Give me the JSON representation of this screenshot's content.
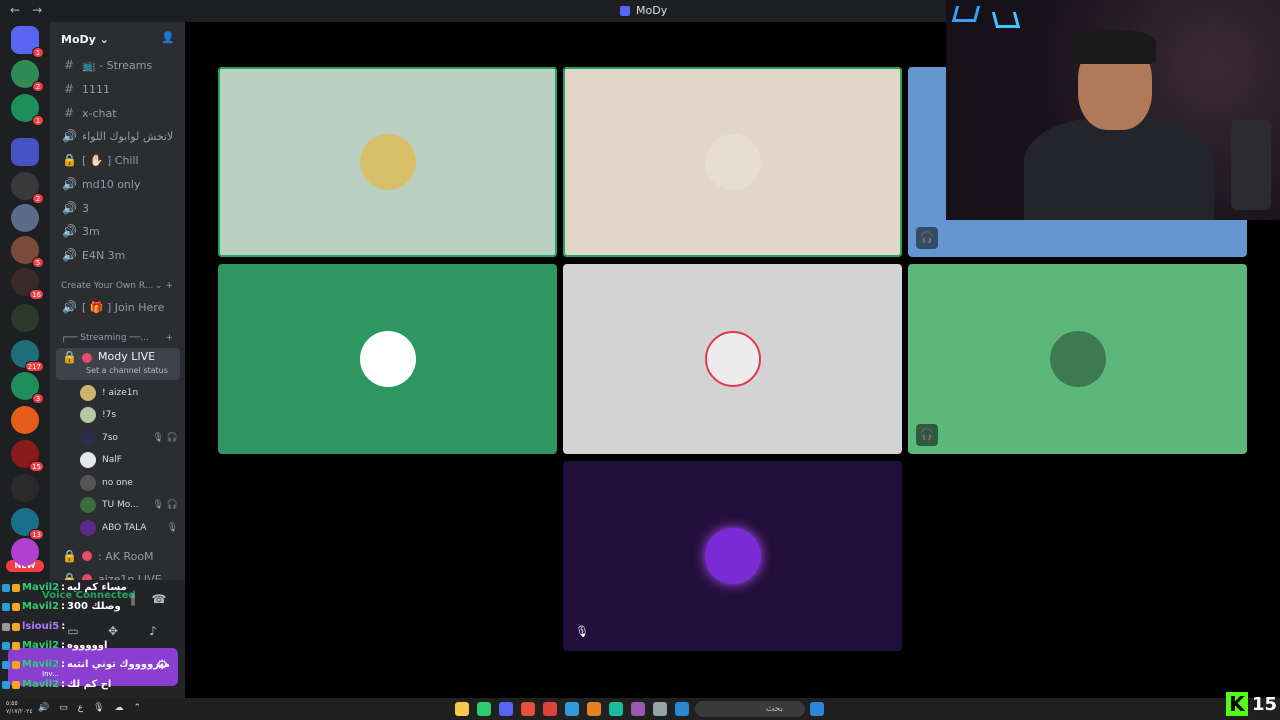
{
  "window": {
    "title": "MoDy",
    "back": "←",
    "forward": "→"
  },
  "rail": {
    "servers": [
      {
        "name": "discord-home",
        "badge": "1",
        "color": "#5865f2"
      },
      {
        "name": "server-palm",
        "badge": "2",
        "color": "#2e8b57"
      },
      {
        "name": "server-gears",
        "badge": "1",
        "color": "#1e8e5a"
      },
      {
        "name": "folder",
        "badge": "",
        "color": "#4752c4"
      },
      {
        "name": "server-a",
        "badge": "2",
        "color": "#3a3a3a"
      },
      {
        "name": "server-b",
        "badge": "",
        "color": "#5b6c8a"
      },
      {
        "name": "server-c",
        "badge": "5",
        "color": "#7a4b3a"
      },
      {
        "name": "server-d",
        "badge": "16",
        "color": "#3a2a2a"
      },
      {
        "name": "server-e",
        "badge": "",
        "color": "#2c3a2a"
      },
      {
        "name": "server-f",
        "badge": "217",
        "color": "#1f6d7a"
      },
      {
        "name": "server-g",
        "badge": "3",
        "color": "#1e8e5a"
      },
      {
        "name": "server-h",
        "badge": "",
        "color": "#e65c1a"
      },
      {
        "name": "server-i",
        "badge": "15",
        "color": "#8b1a1a"
      },
      {
        "name": "server-j",
        "badge": "",
        "color": "#2a2a2a"
      },
      {
        "name": "server-k",
        "badge": "13",
        "color": "#1b6f8a"
      },
      {
        "name": "server-l",
        "badge": "",
        "color": "#b040d0"
      }
    ],
    "new_label": "NEW"
  },
  "sidebar": {
    "server_name": "MoDy",
    "channels": [
      {
        "icon": "#",
        "label": "📺 - Streams",
        "type": "text"
      },
      {
        "icon": "#",
        "label": "1111",
        "type": "text"
      },
      {
        "icon": "#",
        "label": "x-chat",
        "type": "text"
      },
      {
        "icon": "🔊",
        "label": "لاتخش لوابوك اللواء",
        "type": "voice"
      },
      {
        "icon": "🔒",
        "label": "[ ✋🏻 ] Chill",
        "type": "voice"
      },
      {
        "icon": "🔊",
        "label": "md10 only",
        "type": "voice"
      },
      {
        "icon": "🔊",
        "label": "3",
        "type": "voice"
      },
      {
        "icon": "🔊",
        "label": "3m",
        "type": "voice"
      },
      {
        "icon": "🔊",
        "label": "E4N 3m",
        "type": "voice"
      }
    ],
    "category_create": "Create Your Own R...",
    "join_here": "[ 🎁 ] Join Here",
    "category_streaming": "┌── Streaming ──...",
    "active_channel": {
      "label": "Mody LIVE",
      "status": "Set a channel status"
    },
    "members": [
      {
        "name": "! aize1n",
        "icons": ""
      },
      {
        "name": "!7s",
        "icons": ""
      },
      {
        "name": "7so",
        "icons": "🎙 🎧"
      },
      {
        "name": "NalF",
        "icons": ""
      },
      {
        "name": "no one",
        "icons": ""
      },
      {
        "name": "TU Mo...",
        "icons": "🎙 🎧"
      },
      {
        "name": "ABO TALA",
        "icons": "🎙"
      }
    ],
    "more_channels": [
      {
        "label": ": AK RooM"
      },
      {
        "label": "aize1n LIVE"
      }
    ]
  },
  "voice_panel": {
    "status": "Voice Connected",
    "activity_label": "Inv..."
  },
  "chat": [
    {
      "name": "Mavil2",
      "sep": ":",
      "message": "مساء كم ليه",
      "badge": "#2d9cdb"
    },
    {
      "name": "Mavil2",
      "sep": ":",
      "message": "300 وصلك",
      "badge": "#2d9cdb"
    },
    {
      "name": "lsioui5",
      "sep": ":",
      "message": "",
      "badge": "#f5a623"
    },
    {
      "name": "Mavil2",
      "sep": ":",
      "message": "اوووووه",
      "badge": "#2d9cdb"
    },
    {
      "name": "Mavil2",
      "sep": ":",
      "message": "مبرووووك توني انتبه",
      "badge": "#2d9cdb"
    },
    {
      "name": "Mavil2",
      "sep": ":",
      "message": "اح كم لك",
      "badge": "#2d9cdb"
    }
  ],
  "tiles": [
    {
      "name": "tile-1",
      "bg": "#b9d0c2",
      "speaking": true,
      "avatar": "#d8c06a",
      "icon": ""
    },
    {
      "name": "tile-2",
      "bg": "#e2d5c9",
      "speaking": true,
      "avatar": "#e8ddd2",
      "icon": ""
    },
    {
      "name": "tile-3",
      "bg": "#6596cf",
      "speaking": false,
      "avatar": "",
      "icon": "🎧"
    },
    {
      "name": "tile-4",
      "bg": "#2e9660",
      "speaking": false,
      "avatar": "#ffffff",
      "icon": ""
    },
    {
      "name": "tile-5",
      "bg": "#d3d3d3",
      "speaking": false,
      "avatar": "#ececec",
      "icon": ""
    },
    {
      "name": "tile-6",
      "bg": "#5cb77a",
      "speaking": false,
      "avatar": "#3d7a52",
      "icon": "🎧"
    },
    {
      "name": "tile-7",
      "bg": "#230f3b",
      "speaking": false,
      "avatar": "#7a2bd6",
      "icon": "🎙"
    }
  ],
  "taskbar": {
    "clock": "٥:٥٥\n٧/١٧/٢٠٢٤",
    "sys_lang": "ع",
    "search_placeholder": "بحث"
  },
  "kick": {
    "k": "K",
    "count": "15"
  }
}
